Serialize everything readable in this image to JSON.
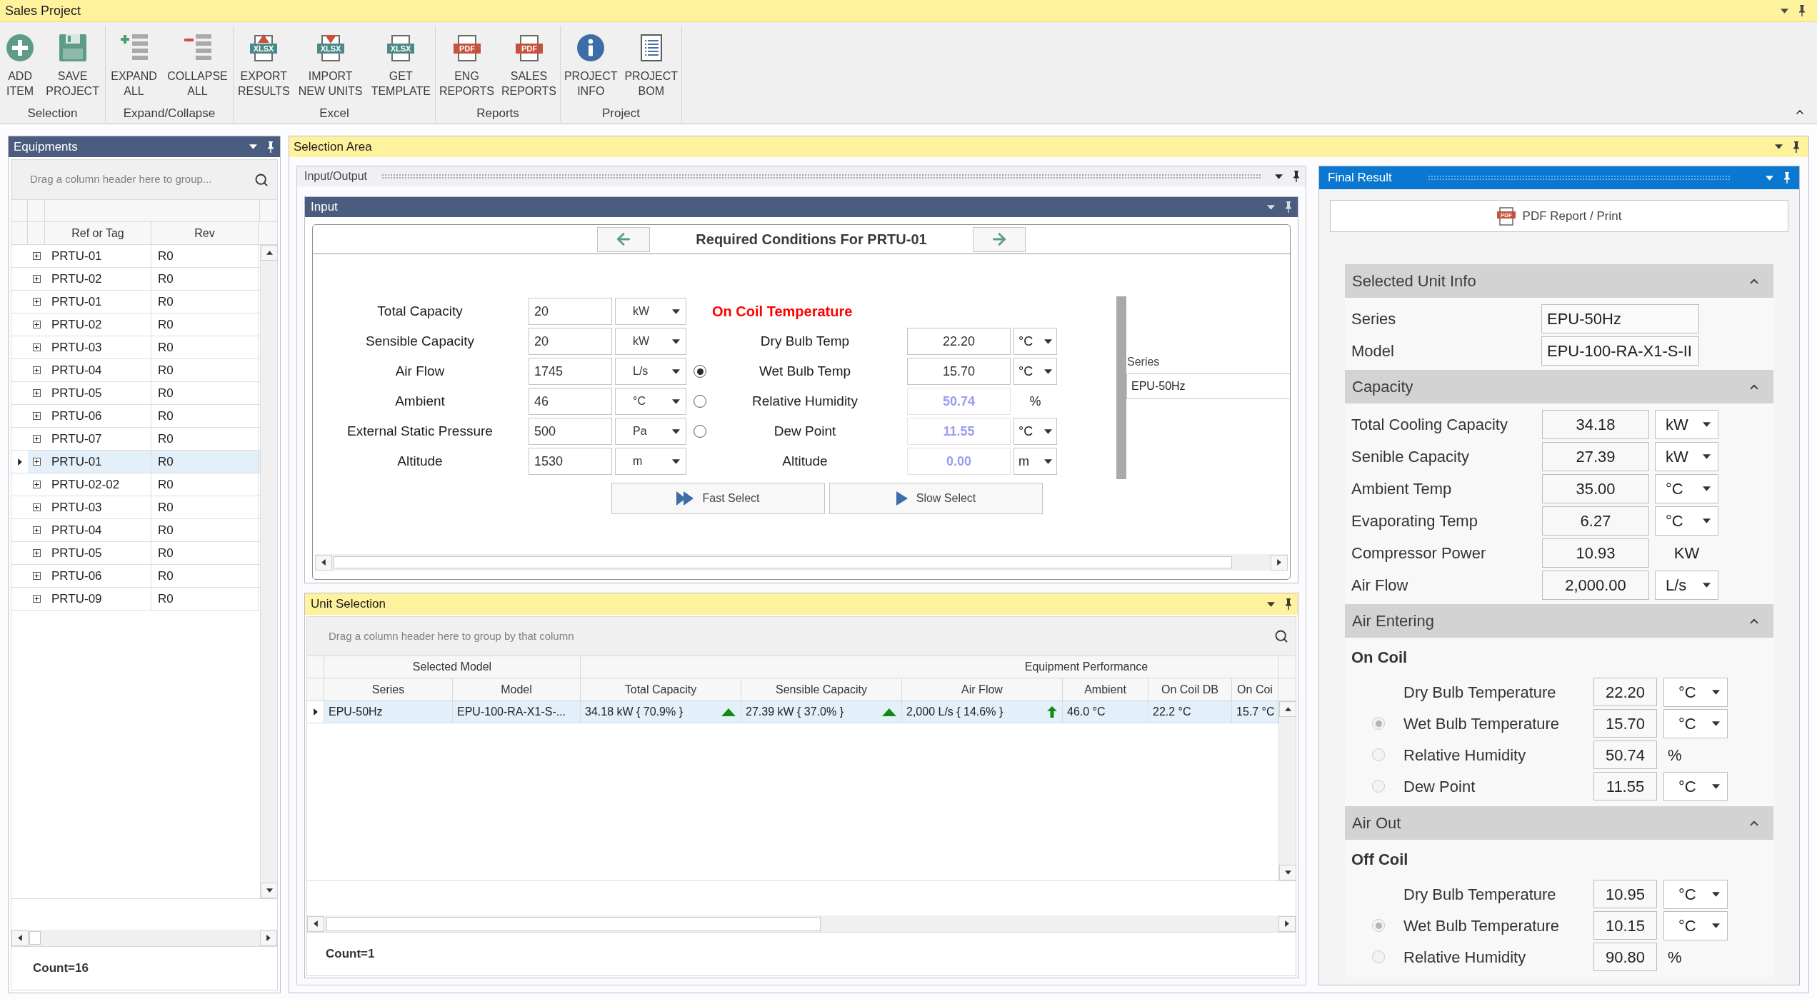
{
  "window": {
    "title": "Sales Project"
  },
  "ribbon": {
    "groups": [
      {
        "label": "Selection",
        "buttons": [
          {
            "kind": "add",
            "lines": [
              "ADD",
              "ITEM"
            ]
          },
          {
            "kind": "save",
            "lines": [
              "SAVE",
              "PROJECT"
            ]
          }
        ]
      },
      {
        "label": "Expand/Collapse",
        "buttons": [
          {
            "kind": "expand",
            "lines": [
              "EXPAND",
              "ALL"
            ]
          },
          {
            "kind": "collapse",
            "lines": [
              "COLLAPSE",
              "ALL"
            ]
          }
        ]
      },
      {
        "label": "Excel",
        "buttons": [
          {
            "kind": "xlsx-up",
            "badge": "XLSX",
            "lines": [
              "EXPORT",
              "RESULTS"
            ]
          },
          {
            "kind": "xlsx-down",
            "badge": "XLSX",
            "lines": [
              "IMPORT",
              "NEW UNITS"
            ]
          },
          {
            "kind": "xlsx",
            "badge": "XLSX",
            "lines": [
              "GET",
              "TEMPLATE"
            ]
          }
        ]
      },
      {
        "label": "Reports",
        "buttons": [
          {
            "kind": "pdf",
            "badge": "PDF",
            "lines": [
              "ENG",
              "REPORTS"
            ]
          },
          {
            "kind": "pdf",
            "badge": "PDF",
            "lines": [
              "SALES",
              "REPORTS"
            ]
          }
        ]
      },
      {
        "label": "Project",
        "buttons": [
          {
            "kind": "info",
            "lines": [
              "PROJECT",
              "INFO"
            ]
          },
          {
            "kind": "list",
            "lines": [
              "PROJECT",
              "BOM"
            ]
          }
        ]
      }
    ]
  },
  "equipments": {
    "title": "Equipments",
    "group_hint": "Drag a column header here to group...",
    "columns": [
      "Ref or Tag",
      "Rev"
    ],
    "rows": [
      {
        "tag": "PRTU-01",
        "rev": "R0",
        "selected": false
      },
      {
        "tag": "PRTU-02",
        "rev": "R0",
        "selected": false
      },
      {
        "tag": "PRTU-01",
        "rev": "R0",
        "selected": false
      },
      {
        "tag": "PRTU-02",
        "rev": "R0",
        "selected": false
      },
      {
        "tag": "PRTU-03",
        "rev": "R0",
        "selected": false
      },
      {
        "tag": "PRTU-04",
        "rev": "R0",
        "selected": false
      },
      {
        "tag": "PRTU-05",
        "rev": "R0",
        "selected": false
      },
      {
        "tag": "PRTU-06",
        "rev": "R0",
        "selected": false
      },
      {
        "tag": "PRTU-07",
        "rev": "R0",
        "selected": false
      },
      {
        "tag": "PRTU-01",
        "rev": "R0",
        "selected": true
      },
      {
        "tag": "PRTU-02-02",
        "rev": "R0",
        "selected": false
      },
      {
        "tag": "PRTU-03",
        "rev": "R0",
        "selected": false
      },
      {
        "tag": "PRTU-04",
        "rev": "R0",
        "selected": false
      },
      {
        "tag": "PRTU-05",
        "rev": "R0",
        "selected": false
      },
      {
        "tag": "PRTU-06",
        "rev": "R0",
        "selected": false
      },
      {
        "tag": "PRTU-09",
        "rev": "R0",
        "selected": false
      }
    ],
    "footer": "Count=16"
  },
  "selection_area": {
    "title": "Selection Area",
    "dock_title": "Input/Output",
    "input": {
      "title": "Input",
      "heading": "Required Conditions For PRTU-01",
      "fields": [
        {
          "label": "Total Capacity",
          "value": "20",
          "unit": "kW"
        },
        {
          "label": "Sensible Capacity",
          "value": "20",
          "unit": "kW"
        },
        {
          "label": "Air Flow",
          "value": "1745",
          "unit": "L/s"
        },
        {
          "label": "Ambient",
          "value": "46",
          "unit": "°C"
        },
        {
          "label": "External Static Pressure",
          "value": "500",
          "unit": "Pa"
        },
        {
          "label": "Altitude",
          "value": "1530",
          "unit": "m"
        }
      ],
      "on_coil": {
        "title": "On Coil Temperature",
        "fields": [
          {
            "kind": "plain",
            "label": "Dry Bulb Temp",
            "value": "22.20",
            "unit": "°C",
            "unit_dropdown": true,
            "calculated": false
          },
          {
            "kind": "radio",
            "label": "Wet Bulb Temp",
            "value": "15.70",
            "unit": "°C",
            "unit_dropdown": true,
            "calculated": false,
            "selected": true
          },
          {
            "kind": "radio",
            "label": "Relative Humidity",
            "value": "50.74",
            "unit": "%",
            "unit_dropdown": false,
            "calculated": true,
            "selected": false
          },
          {
            "kind": "radio",
            "label": "Dew Point",
            "value": "11.55",
            "unit": "°C",
            "unit_dropdown": true,
            "calculated": true,
            "selected": false
          },
          {
            "kind": "plain",
            "label": "Altitude",
            "value": "0.00",
            "unit": "m",
            "unit_dropdown": true,
            "calculated": true
          }
        ]
      },
      "buttons": [
        {
          "kind": "fast",
          "label": "Fast Select"
        },
        {
          "kind": "slow",
          "label": "Slow Select"
        }
      ],
      "series": {
        "label": "Series",
        "value": "EPU-50Hz"
      }
    },
    "unit_selection": {
      "title": "Unit Selection",
      "group_hint": "Drag a column header here to group by that column",
      "bands": [
        {
          "label": "Selected Model",
          "columns": [
            "Series",
            "Model"
          ]
        },
        {
          "label": "Equipment Performance",
          "columns": [
            "Total Capacity",
            "Sensible Capacity",
            "Air Flow",
            "Ambient",
            "On Coil DB",
            "On Coi"
          ]
        }
      ],
      "rows": [
        {
          "selected": true,
          "cells": [
            {
              "kind": "plain",
              "text": "EPU-50Hz"
            },
            {
              "kind": "plain",
              "text": "EPU-100-RA-X1-S-..."
            },
            {
              "kind": "triangle",
              "text": "34.18 kW { 70.9% }"
            },
            {
              "kind": "triangle",
              "text": "27.39 kW { 37.0% }"
            },
            {
              "kind": "arrow",
              "text": "2,000 L/s { 14.6% }"
            },
            {
              "kind": "plain",
              "text": "46.0 °C"
            },
            {
              "kind": "plain",
              "text": "22.2 °C"
            },
            {
              "kind": "plain",
              "text": "15.7 °C"
            }
          ]
        }
      ],
      "footer": "Count=1"
    },
    "final_result": {
      "title": "Final Result",
      "pdf_button": {
        "badge": "PDF",
        "label": "PDF Report / Print"
      },
      "sections": [
        {
          "title": "Selected Unit Info",
          "expanded": true,
          "rows": [
            {
              "kind": "text",
              "label": "Series",
              "value": "EPU-50Hz"
            },
            {
              "kind": "text",
              "label": "Model",
              "value": "EPU-100-RA-X1-S-II"
            }
          ]
        },
        {
          "title": "Capacity",
          "expanded": true,
          "rows": [
            {
              "kind": "measure",
              "label": "Total Cooling Capacity",
              "value": "34.18",
              "unit": "kW",
              "unit_dropdown": true
            },
            {
              "kind": "measure",
              "label": "Senible Capacity",
              "value": "27.39",
              "unit": "kW",
              "unit_dropdown": true
            },
            {
              "kind": "measure",
              "label": "Ambient Temp",
              "value": "35.00",
              "unit": "°C",
              "unit_dropdown": true
            },
            {
              "kind": "measure",
              "label": "Evaporating Temp",
              "value": "6.27",
              "unit": "°C",
              "unit_dropdown": true
            },
            {
              "kind": "measure",
              "label": "Compressor Power",
              "value": "10.93",
              "unit": "KW",
              "unit_dropdown": false
            },
            {
              "kind": "measure",
              "label": "Air Flow",
              "value": "2,000.00",
              "unit": "L/s",
              "unit_dropdown": true
            }
          ]
        },
        {
          "title": "Air Entering",
          "expanded": true,
          "subtitle": "On Coil",
          "rows": [
            {
              "kind": "air",
              "label": "Dry Bulb Temperature",
              "value": "22.20",
              "unit": "°C",
              "unit_dropdown": true
            },
            {
              "kind": "air-radio",
              "label": "Wet Bulb Temperature",
              "value": "15.70",
              "unit": "°C",
              "unit_dropdown": true,
              "selected": true
            },
            {
              "kind": "air-radio",
              "label": "Relative Humidity",
              "value": "50.74",
              "unit": "%",
              "unit_dropdown": false,
              "selected": false
            },
            {
              "kind": "air-radio",
              "label": "Dew Point",
              "value": "11.55",
              "unit": "°C",
              "unit_dropdown": true,
              "selected": false
            }
          ]
        },
        {
          "title": "Air Out",
          "expanded": true,
          "subtitle": "Off Coil",
          "rows": [
            {
              "kind": "air",
              "label": "Dry Bulb Temperature",
              "value": "10.95",
              "unit": "°C",
              "unit_dropdown": true
            },
            {
              "kind": "air-radio",
              "label": "Wet Bulb Temperature",
              "value": "10.15",
              "unit": "°C",
              "unit_dropdown": true,
              "selected": true
            },
            {
              "kind": "air-radio",
              "label": "Relative Humidity",
              "value": "90.80",
              "unit": "%",
              "unit_dropdown": false,
              "selected": false
            }
          ]
        }
      ]
    }
  }
}
